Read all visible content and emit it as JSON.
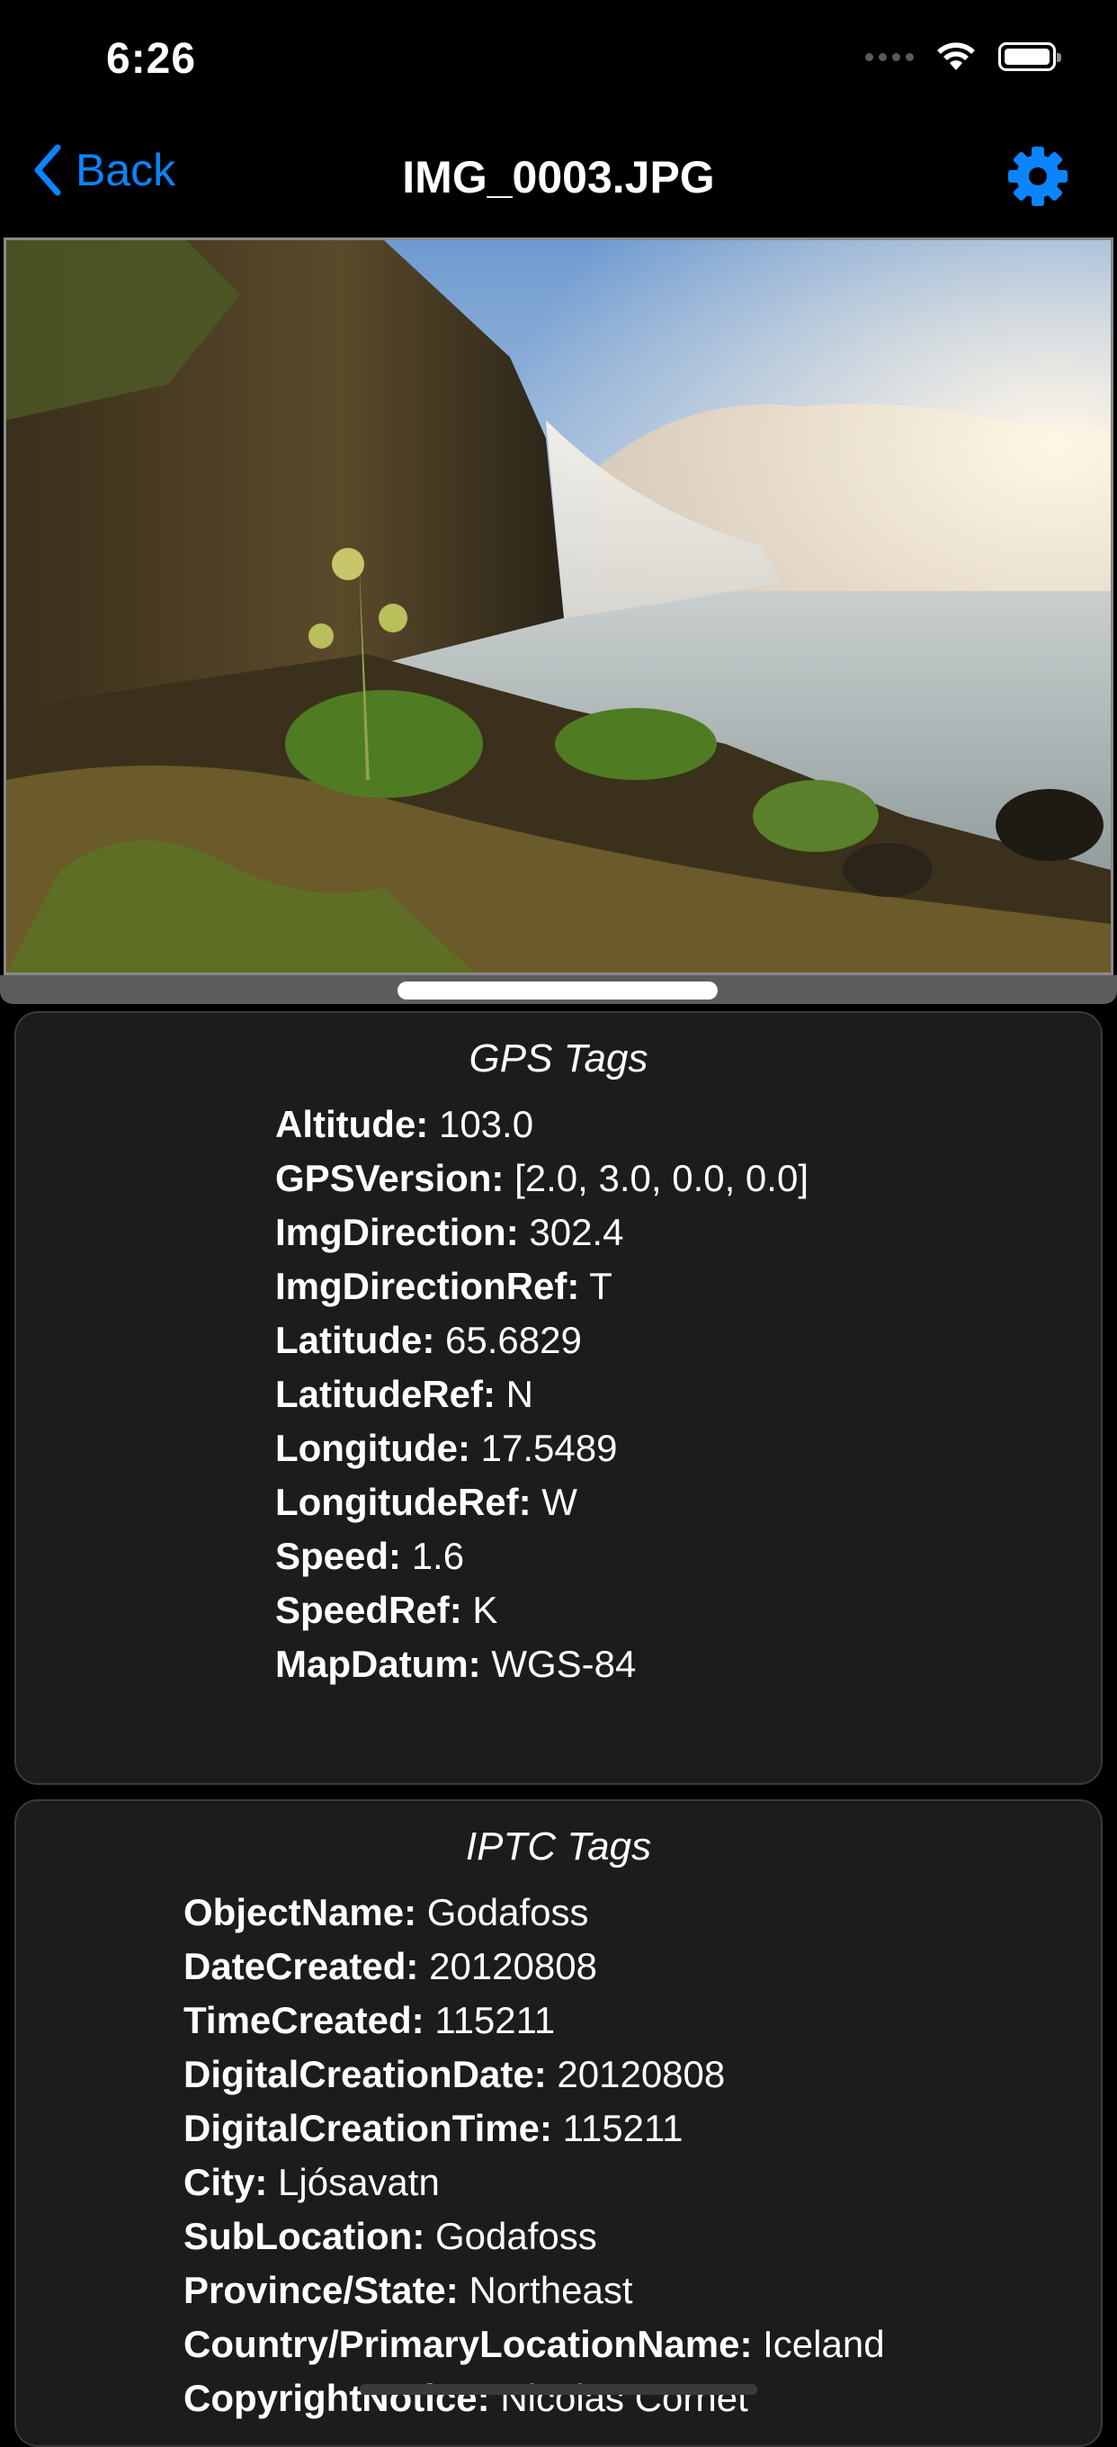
{
  "status_bar": {
    "time": "6:26"
  },
  "nav": {
    "back_label": "Back",
    "title": "IMG_0003.JPG"
  },
  "colors": {
    "accent": "#0a84ff",
    "background": "#000000",
    "card": "#1c1c1e"
  },
  "icons": {
    "back": "chevron-left-icon",
    "settings": "gear-icon",
    "wifi": "wifi-icon",
    "battery": "battery-icon"
  },
  "gps": {
    "title": "GPS Tags",
    "rows": [
      {
        "key": "Altitude:",
        "value": "103.0"
      },
      {
        "key": "GPSVersion:",
        "value": "[2.0, 3.0, 0.0, 0.0]"
      },
      {
        "key": "ImgDirection:",
        "value": "302.4"
      },
      {
        "key": "ImgDirectionRef:",
        "value": "T"
      },
      {
        "key": "Latitude:",
        "value": "65.6829"
      },
      {
        "key": "LatitudeRef:",
        "value": "N"
      },
      {
        "key": "Longitude:",
        "value": "17.5489"
      },
      {
        "key": "LongitudeRef:",
        "value": "W"
      },
      {
        "key": "Speed:",
        "value": "1.6"
      },
      {
        "key": "SpeedRef:",
        "value": "K"
      },
      {
        "key": "MapDatum:",
        "value": "WGS-84"
      }
    ]
  },
  "iptc": {
    "title": "IPTC Tags",
    "rows": [
      {
        "key": "ObjectName:",
        "value": "Godafoss"
      },
      {
        "key": "DateCreated:",
        "value": "20120808"
      },
      {
        "key": "TimeCreated:",
        "value": "115211"
      },
      {
        "key": "DigitalCreationDate:",
        "value": "20120808"
      },
      {
        "key": "DigitalCreationTime:",
        "value": "115211"
      },
      {
        "key": "City:",
        "value": "Ljósavatn"
      },
      {
        "key": "SubLocation:",
        "value": "Godafoss"
      },
      {
        "key": "Province/State:",
        "value": "Northeast"
      },
      {
        "key": "Country/PrimaryLocationName:",
        "value": "Iceland"
      },
      {
        "key": "CopyrightNotice:",
        "value": "Nicolas Cornet"
      }
    ]
  }
}
